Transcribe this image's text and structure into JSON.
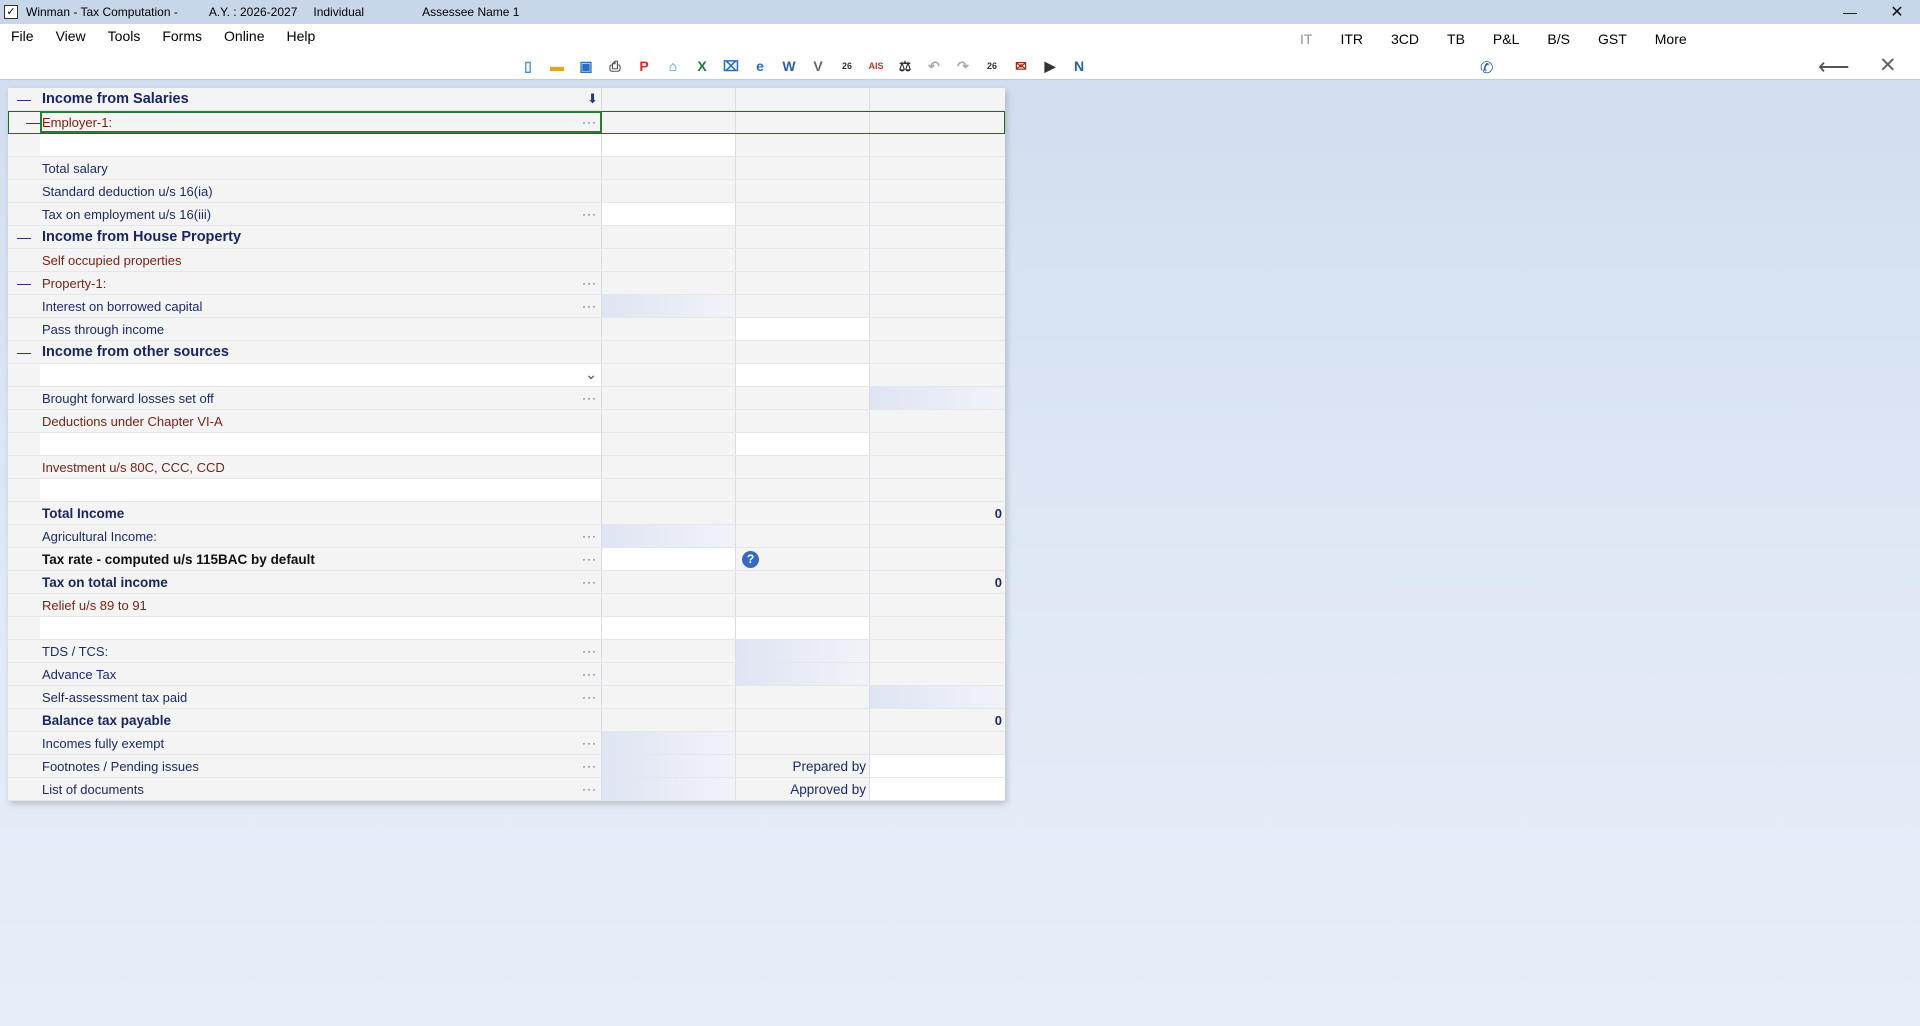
{
  "titlebar": {
    "app": "Winman - Tax Computation -",
    "ay": "A.Y. : 2026-2027",
    "type": "Individual",
    "assessee": "Assessee Name 1",
    "minimize": "—",
    "close": "✕"
  },
  "menu": [
    "File",
    "View",
    "Tools",
    "Forms",
    "Online",
    "Help"
  ],
  "modules": [
    "IT",
    "ITR",
    "3CD",
    "TB",
    "P&L",
    "B/S",
    "GST",
    "More"
  ],
  "toolbar_icons": [
    "new-icon",
    "open-icon",
    "save-icon",
    "print-icon",
    "pdf-icon",
    "home-icon",
    "excel-icon",
    "lock-icon",
    "ie-icon",
    "word-icon",
    "verify-icon",
    "26as-icon",
    "ais-icon",
    "balance-icon",
    "undo-icon",
    "redo-icon",
    "26as-ais-icon",
    "stamp-icon",
    "media-icon",
    "notes-icon"
  ],
  "toolbar_glyphs": [
    "▯",
    "▬",
    "▣",
    "⎙",
    "P",
    "⌂",
    "X",
    "⌧",
    "e",
    "W",
    "V",
    "26",
    "AIS",
    "⚖",
    "↶",
    "↷",
    "26",
    "✉",
    "▶",
    "N"
  ],
  "rows": [
    {
      "tog": "—",
      "label": "Income from Salaries",
      "style": "head",
      "dl": true,
      "v1": "",
      "v2": "",
      "v3": ""
    },
    {
      "tog": "—",
      "label": "Employer-1:",
      "style": "brown",
      "dots": true,
      "selected": true,
      "v1": "",
      "v2": "",
      "v3": ""
    },
    {
      "tog": "",
      "label": "",
      "style": "white-label",
      "v1": "white",
      "v2": "",
      "v3": ""
    },
    {
      "tog": "",
      "label": "Total salary",
      "style": "",
      "v1": "",
      "v2": "",
      "v3": ""
    },
    {
      "tog": "",
      "label": "Standard deduction u/s 16(ia)",
      "style": "",
      "v1": "",
      "v2": "",
      "v3": ""
    },
    {
      "tog": "",
      "label": "Tax on employment u/s 16(iii)",
      "style": "",
      "dots": true,
      "v1": "white",
      "v2": "",
      "v3": ""
    },
    {
      "tog": "—",
      "label": "Income from House Property",
      "style": "head",
      "v1": "",
      "v2": "",
      "v3": ""
    },
    {
      "tog": "",
      "label": "Self occupied properties",
      "style": "brown",
      "v1": "",
      "v2": "",
      "v3": ""
    },
    {
      "tog": "—",
      "label": "Property-1:",
      "style": "brown",
      "dots": true,
      "v1": "",
      "v2": "",
      "v3": ""
    },
    {
      "tog": "",
      "label": "Interest on borrowed capital",
      "style": "",
      "dots": true,
      "v1": "shade",
      "v2": "",
      "v3": ""
    },
    {
      "tog": "",
      "label": "Pass through income",
      "style": "",
      "v1": "",
      "v2": "white",
      "v3": ""
    },
    {
      "tog": "—",
      "label": "Income from other sources",
      "style": "head",
      "v1": "",
      "v2": "",
      "v3": ""
    },
    {
      "tog": "",
      "label": "",
      "style": "white-label",
      "chev": true,
      "v1": "",
      "v2": "white",
      "v3": ""
    },
    {
      "tog": "",
      "label": "Brought forward losses set off",
      "style": "",
      "dots": true,
      "v1": "",
      "v2": "",
      "v3": "shade"
    },
    {
      "tog": "",
      "label": "Deductions under Chapter VI-A",
      "style": "brown",
      "v1": "",
      "v2": "",
      "v3": ""
    },
    {
      "tog": "",
      "label": "",
      "style": "white-label",
      "v1": "",
      "v2": "white",
      "v3": ""
    },
    {
      "tog": "",
      "label": "Investment u/s 80C, CCC, CCD",
      "style": "brown",
      "v1": "",
      "v2": "",
      "v3": ""
    },
    {
      "tog": "",
      "label": "",
      "style": "white-label",
      "v1": "",
      "v2": "",
      "v3": ""
    },
    {
      "tog": "",
      "label": "Total Income",
      "style": "bold",
      "v1": "",
      "v2": "",
      "v3": "0"
    },
    {
      "tog": "",
      "label": "Agricultural Income:",
      "style": "",
      "dots": true,
      "v1": "shade",
      "v2": "",
      "v3": ""
    },
    {
      "tog": "",
      "label": "Tax rate   -   computed u/s 115BAC by default",
      "style": "bold-dark",
      "dots": true,
      "v1": "white",
      "v2": "help",
      "v3": ""
    },
    {
      "tog": "",
      "label": "Tax on total income",
      "style": "bold",
      "dots": true,
      "v1": "",
      "v2": "",
      "v3": "0"
    },
    {
      "tog": "",
      "label": "Relief u/s 89 to 91",
      "style": "brown",
      "v1": "",
      "v2": "",
      "v3": ""
    },
    {
      "tog": "",
      "label": "",
      "style": "white-label",
      "v1": "white",
      "v2": "white",
      "v3": ""
    },
    {
      "tog": "",
      "label": "TDS / TCS:",
      "style": "",
      "dots": true,
      "v1": "",
      "v2": "shade",
      "v3": ""
    },
    {
      "tog": "",
      "label": "Advance Tax",
      "style": "",
      "dots": true,
      "v1": "",
      "v2": "shade",
      "v3": ""
    },
    {
      "tog": "",
      "label": "Self-assessment tax paid",
      "style": "",
      "dots": true,
      "v1": "",
      "v2": "",
      "v3": "shade"
    },
    {
      "tog": "",
      "label": "Balance tax payable",
      "style": "bold",
      "v1": "",
      "v2": "",
      "v3": "0"
    },
    {
      "tog": "",
      "label": "Incomes fully exempt",
      "style": "",
      "dots": true,
      "v1": "shade",
      "v2": "",
      "v3": ""
    },
    {
      "tog": "",
      "label": "Footnotes / Pending issues",
      "style": "",
      "dots": true,
      "v1": "shade",
      "v2": "Prepared by",
      "v3": "white"
    },
    {
      "tog": "",
      "label": "List of documents",
      "style": "",
      "dots": true,
      "v1": "shade",
      "v2": "Approved by",
      "v3": "white"
    }
  ],
  "colors": {
    "accent": "#1c2a6b",
    "brown": "#7a1f12",
    "selection": "#2c7a3a"
  }
}
